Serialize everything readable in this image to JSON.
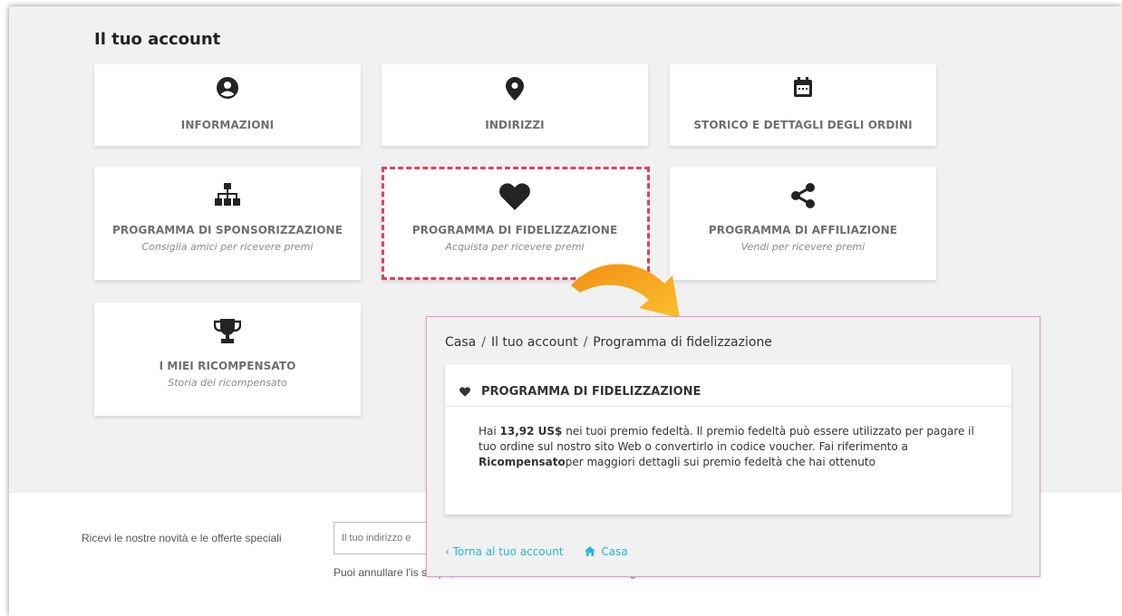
{
  "page": {
    "title": "Il tuo account"
  },
  "tiles": [
    {
      "title": "INFORMAZIONI",
      "icon": "user-circle-icon"
    },
    {
      "title": "INDIRIZZI",
      "icon": "map-pin-icon"
    },
    {
      "title": "STORICO E DETTAGLI DEGLI ORDINI",
      "icon": "calendar-icon"
    },
    {
      "title": "PROGRAMMA DI SPONSORIZZAZIONE",
      "subtitle": "Consiglia amici per ricevere premi",
      "icon": "sitemap-icon"
    },
    {
      "title": "PROGRAMMA DI FIDELIZZAZIONE",
      "subtitle": "Acquista per ricevere premi",
      "icon": "heart-icon"
    },
    {
      "title": "PROGRAMMA DI AFFILIAZIONE",
      "subtitle": "Vendi per ricevere premi",
      "icon": "share-icon"
    },
    {
      "title": "I MIEI RICOMPENSATO",
      "subtitle": "Storia dei ricompensato",
      "icon": "trophy-icon"
    }
  ],
  "newsletter": {
    "label": "Ricevi le nostre novità e le offerte speciali",
    "placeholder": "Il tuo indirizzo e",
    "note": "Puoi annullare l'is scopo, cerca le info di contatto nelle note legali."
  },
  "popup": {
    "breadcrumb": [
      "Casa",
      "Il tuo account",
      "Programma di fidelizzazione"
    ],
    "breadcrumb_sep": "/",
    "card_title": "PROGRAMMA DI FIDELIZZAZIONE",
    "body": {
      "text1": "Hai ",
      "amount": "13,92 US$",
      "text2": " nei tuoi premio fedeltà. Il premio fedeltà può essere utilizzato per pagare il tuo ordine sul nostro sito Web o convertirlo in codice voucher. Fai riferimento a ",
      "link": "Ricompensato",
      "text3": "per maggiori dettagli sui premio fedeltà che hai ottenuto"
    },
    "back_link": "‹ Torna al tuo account",
    "home_link": "Casa"
  },
  "colors": {
    "highlight": "#e0425b",
    "link": "#24b9d7",
    "arrow": "#f7a21b"
  }
}
